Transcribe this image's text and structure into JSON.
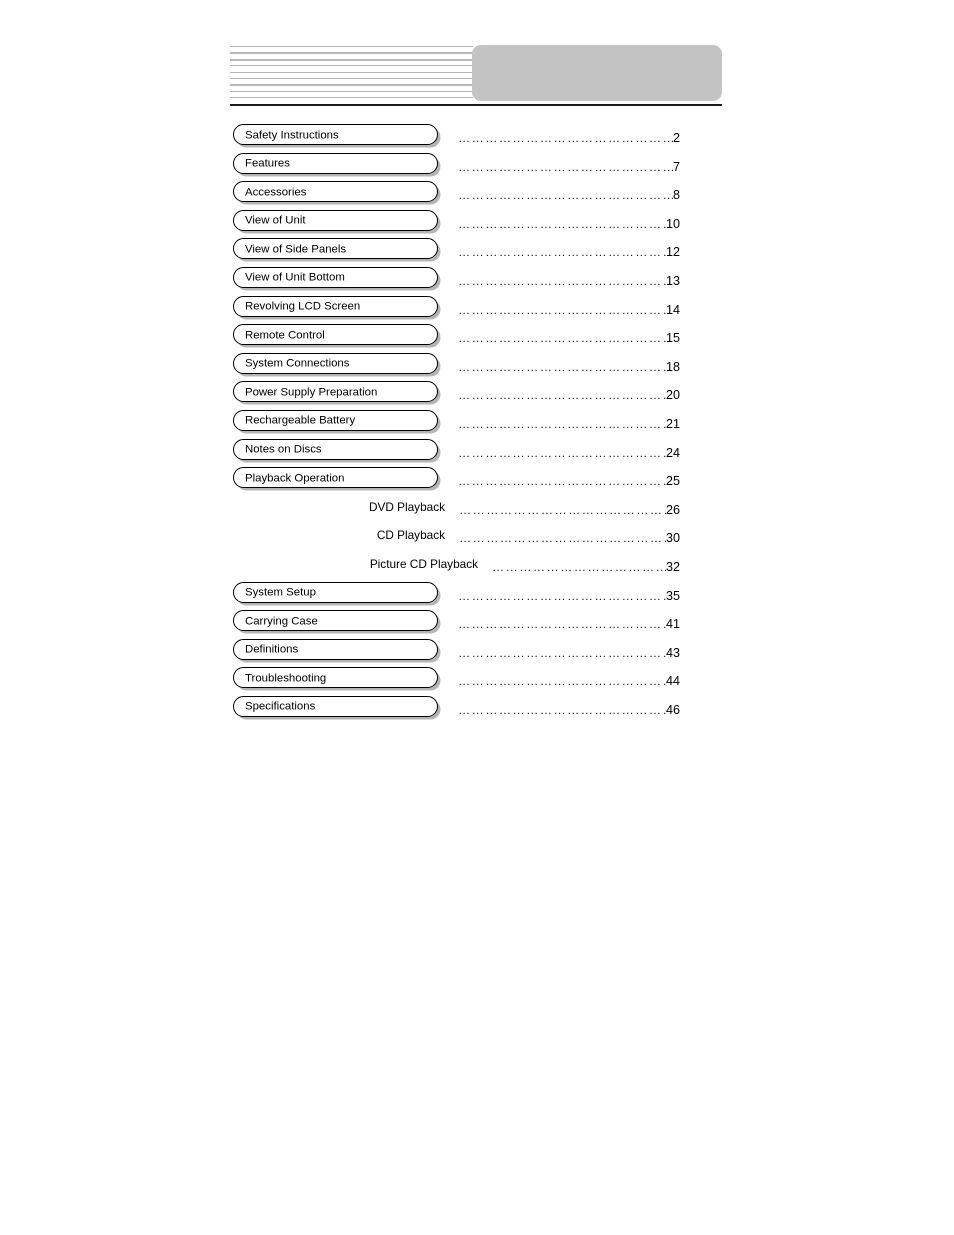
{
  "page": {
    "document_type": "table-of-contents",
    "leader_dots": "……………………………………………",
    "leader_dots_short": "………………………………"
  },
  "header": {
    "stripe_count": 9,
    "stripe_color": "#b8b8b8",
    "block_color": "#c4c4c4",
    "rule_color": "#1a1a1a"
  },
  "toc": {
    "entries": [
      {
        "label": "Safety Instructions",
        "page": "2",
        "type": "main"
      },
      {
        "label": "Features",
        "page": "7",
        "type": "main"
      },
      {
        "label": "Accessories",
        "page": "8",
        "type": "main"
      },
      {
        "label": "View of Unit",
        "page": "10",
        "type": "main"
      },
      {
        "label": "View of Side Panels",
        "page": "12",
        "type": "main"
      },
      {
        "label": "View of Unit Bottom",
        "page": "13",
        "type": "main"
      },
      {
        "label": "Revolving LCD Screen",
        "page": "14",
        "type": "main"
      },
      {
        "label": "Remote Control",
        "page": "15",
        "type": "main"
      },
      {
        "label": "System Connections",
        "page": "18",
        "type": "main"
      },
      {
        "label": "Power Supply Preparation",
        "page": "20",
        "type": "main"
      },
      {
        "label": "Rechargeable Battery",
        "page": "21",
        "type": "main"
      },
      {
        "label": "Notes on Discs",
        "page": "24",
        "type": "main"
      },
      {
        "label": "Playback Operation",
        "page": "25",
        "type": "main"
      },
      {
        "label": "DVD Playback",
        "page": "26",
        "type": "sub"
      },
      {
        "label": "CD Playback",
        "page": "30",
        "type": "sub"
      },
      {
        "label": "Picture CD Playback",
        "page": "32",
        "type": "sub-wide"
      },
      {
        "label": "System Setup",
        "page": "35",
        "type": "main"
      },
      {
        "label": "Carrying Case",
        "page": "41",
        "type": "main"
      },
      {
        "label": "Definitions",
        "page": "43",
        "type": "main"
      },
      {
        "label": "Troubleshooting",
        "page": "44",
        "type": "main"
      },
      {
        "label": "Specifications",
        "page": "46",
        "type": "main"
      }
    ]
  }
}
